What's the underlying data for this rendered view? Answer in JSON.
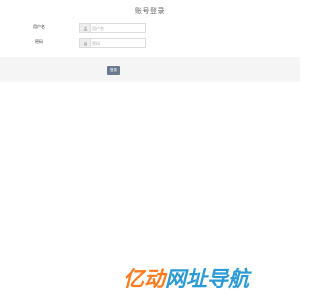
{
  "page": {
    "title": "账号登录"
  },
  "form": {
    "username": {
      "label": "用户名",
      "placeholder": "用户名",
      "value": "",
      "icon": "user-icon"
    },
    "password": {
      "label": "密码",
      "placeholder": "密码",
      "value": "",
      "icon": "lock-icon"
    },
    "submit_label": "登录"
  },
  "brand": {
    "accent_text": "亿动",
    "main_text": "网址导航",
    "accent_color": "#ff7a1a",
    "main_color": "#2a9bd6"
  },
  "colors": {
    "button": "#6c7a8f",
    "band": "#f5f5f5",
    "border": "#dcdcdc"
  }
}
